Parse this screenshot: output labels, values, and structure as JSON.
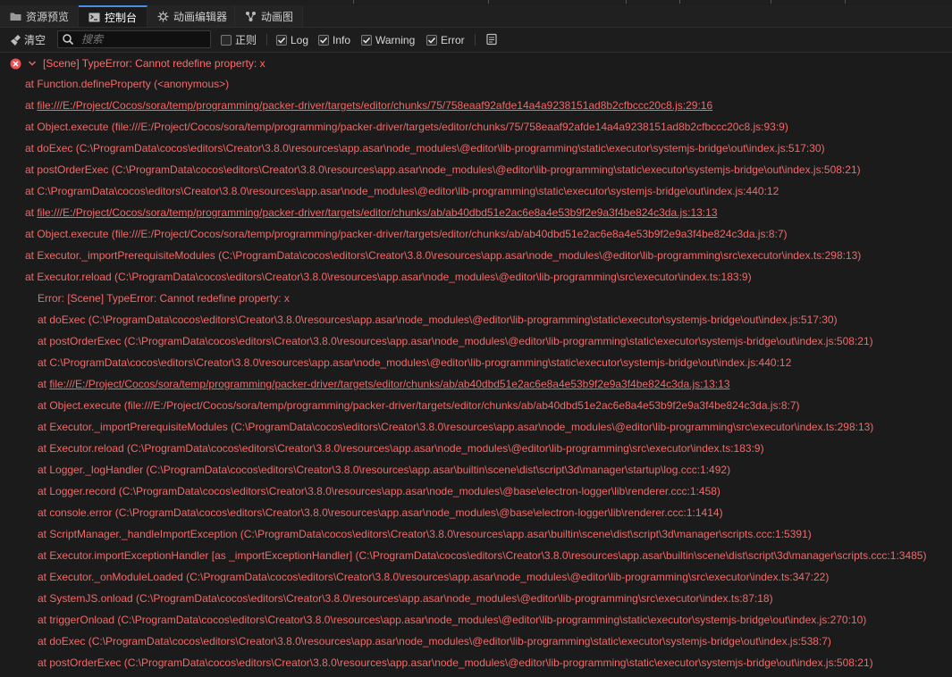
{
  "tabs": [
    {
      "label": "资源预览",
      "icon": "folder-icon",
      "active": false
    },
    {
      "label": "控制台",
      "icon": "terminal-icon",
      "active": true
    },
    {
      "label": "动画编辑器",
      "icon": "animation-editor-icon",
      "active": false
    },
    {
      "label": "动画图",
      "icon": "animation-graph-icon",
      "active": false
    }
  ],
  "toolbar": {
    "clear_label": "清空",
    "search_placeholder": "搜索",
    "regex_label": "正则",
    "log_label": "Log",
    "info_label": "Info",
    "warning_label": "Warning",
    "error_label": "Error",
    "regex_checked": false,
    "log_checked": true,
    "info_checked": true,
    "warning_checked": true,
    "error_checked": true
  },
  "colors": {
    "error_text": "#f06a6a",
    "accent": "#4a90e2",
    "background": "#1b1b1b"
  },
  "log": {
    "header": "[Scene] TypeError: Cannot redefine property: x",
    "lines": [
      {
        "prefix": "at Function.defineProperty (<anonymous>)",
        "link": "",
        "suffix": "",
        "indent": 1
      },
      {
        "prefix": "at ",
        "link": "file:///E:/Project/Cocos/sora/temp/programming/packer-driver/targets/editor/chunks/75/758eaaf92afde14a4a9238151ad8b2cfbccc20c8.js:29:16",
        "suffix": "",
        "indent": 1
      },
      {
        "prefix": "at Object.execute (file:///E:/Project/Cocos/sora/temp/programming/packer-driver/targets/editor/chunks/75/758eaaf92afde14a4a9238151ad8b2cfbccc20c8.js:93:9)",
        "link": "",
        "suffix": "",
        "indent": 1
      },
      {
        "prefix": "at doExec (C:\\ProgramData\\cocos\\editors\\Creator\\3.8.0\\resources\\app.asar\\node_modules\\@editor\\lib-programming\\static\\executor\\systemjs-bridge\\out\\index.js:517:30)",
        "link": "",
        "suffix": "",
        "indent": 1
      },
      {
        "prefix": "at postOrderExec (C:\\ProgramData\\cocos\\editors\\Creator\\3.8.0\\resources\\app.asar\\node_modules\\@editor\\lib-programming\\static\\executor\\systemjs-bridge\\out\\index.js:508:21)",
        "link": "",
        "suffix": "",
        "indent": 1
      },
      {
        "prefix": "at C:\\ProgramData\\cocos\\editors\\Creator\\3.8.0\\resources\\app.asar\\node_modules\\@editor\\lib-programming\\static\\executor\\systemjs-bridge\\out\\index.js:440:12",
        "link": "",
        "suffix": "",
        "indent": 1
      },
      {
        "prefix": "at ",
        "link": "file:///E:/Project/Cocos/sora/temp/programming/packer-driver/targets/editor/chunks/ab/ab40dbd51e2ac6e8a4e53b9f2e9a3f4be824c3da.js:13:13",
        "suffix": "",
        "indent": 1
      },
      {
        "prefix": "at Object.execute (file:///E:/Project/Cocos/sora/temp/programming/packer-driver/targets/editor/chunks/ab/ab40dbd51e2ac6e8a4e53b9f2e9a3f4be824c3da.js:8:7)",
        "link": "",
        "suffix": "",
        "indent": 1
      },
      {
        "prefix": "at Executor._importPrerequisiteModules (C:\\ProgramData\\cocos\\editors\\Creator\\3.8.0\\resources\\app.asar\\node_modules\\@editor\\lib-programming\\src\\executor\\index.ts:298:13)",
        "link": "",
        "suffix": "",
        "indent": 1
      },
      {
        "prefix": "at Executor.reload (C:\\ProgramData\\cocos\\editors\\Creator\\3.8.0\\resources\\app.asar\\node_modules\\@editor\\lib-programming\\src\\executor\\index.ts:183:9)",
        "link": "",
        "suffix": "",
        "indent": 1
      },
      {
        "prefix": "Error: [Scene] TypeError: Cannot redefine property: x",
        "link": "",
        "suffix": "",
        "indent": 2
      },
      {
        "prefix": "at doExec (C:\\ProgramData\\cocos\\editors\\Creator\\3.8.0\\resources\\app.asar\\node_modules\\@editor\\lib-programming\\static\\executor\\systemjs-bridge\\out\\index.js:517:30)",
        "link": "",
        "suffix": "",
        "indent": 2
      },
      {
        "prefix": "at postOrderExec (C:\\ProgramData\\cocos\\editors\\Creator\\3.8.0\\resources\\app.asar\\node_modules\\@editor\\lib-programming\\static\\executor\\systemjs-bridge\\out\\index.js:508:21)",
        "link": "",
        "suffix": "",
        "indent": 2
      },
      {
        "prefix": "at C:\\ProgramData\\cocos\\editors\\Creator\\3.8.0\\resources\\app.asar\\node_modules\\@editor\\lib-programming\\static\\executor\\systemjs-bridge\\out\\index.js:440:12",
        "link": "",
        "suffix": "",
        "indent": 2
      },
      {
        "prefix": "at ",
        "link": "file:///E:/Project/Cocos/sora/temp/programming/packer-driver/targets/editor/chunks/ab/ab40dbd51e2ac6e8a4e53b9f2e9a3f4be824c3da.js:13:13",
        "suffix": "",
        "indent": 2
      },
      {
        "prefix": "at Object.execute (file:///E:/Project/Cocos/sora/temp/programming/packer-driver/targets/editor/chunks/ab/ab40dbd51e2ac6e8a4e53b9f2e9a3f4be824c3da.js:8:7)",
        "link": "",
        "suffix": "",
        "indent": 2
      },
      {
        "prefix": "at Executor._importPrerequisiteModules (C:\\ProgramData\\cocos\\editors\\Creator\\3.8.0\\resources\\app.asar\\node_modules\\@editor\\lib-programming\\src\\executor\\index.ts:298:13)",
        "link": "",
        "suffix": "",
        "indent": 2
      },
      {
        "prefix": "at Executor.reload (C:\\ProgramData\\cocos\\editors\\Creator\\3.8.0\\resources\\app.asar\\node_modules\\@editor\\lib-programming\\src\\executor\\index.ts:183:9)",
        "link": "",
        "suffix": "",
        "indent": 2
      },
      {
        "prefix": "at Logger._logHandler (C:\\ProgramData\\cocos\\editors\\Creator\\3.8.0\\resources\\app.asar\\builtin\\scene\\dist\\script\\3d\\manager\\startup\\log.ccc:1:492)",
        "link": "",
        "suffix": "",
        "indent": 2
      },
      {
        "prefix": "at Logger.record (C:\\ProgramData\\cocos\\editors\\Creator\\3.8.0\\resources\\app.asar\\node_modules\\@base\\electron-logger\\lib\\renderer.ccc:1:458)",
        "link": "",
        "suffix": "",
        "indent": 2
      },
      {
        "prefix": "at console.error (C:\\ProgramData\\cocos\\editors\\Creator\\3.8.0\\resources\\app.asar\\node_modules\\@base\\electron-logger\\lib\\renderer.ccc:1:1414)",
        "link": "",
        "suffix": "",
        "indent": 2
      },
      {
        "prefix": "at ScriptManager._handleImportException (C:\\ProgramData\\cocos\\editors\\Creator\\3.8.0\\resources\\app.asar\\builtin\\scene\\dist\\script\\3d\\manager\\scripts.ccc:1:5391)",
        "link": "",
        "suffix": "",
        "indent": 2
      },
      {
        "prefix": "at Executor.importExceptionHandler [as _importExceptionHandler] (C:\\ProgramData\\cocos\\editors\\Creator\\3.8.0\\resources\\app.asar\\builtin\\scene\\dist\\script\\3d\\manager\\scripts.ccc:1:3485)",
        "link": "",
        "suffix": "",
        "indent": 2
      },
      {
        "prefix": "at Executor._onModuleLoaded (C:\\ProgramData\\cocos\\editors\\Creator\\3.8.0\\resources\\app.asar\\node_modules\\@editor\\lib-programming\\src\\executor\\index.ts:347:22)",
        "link": "",
        "suffix": "",
        "indent": 2
      },
      {
        "prefix": "at SystemJS.onload (C:\\ProgramData\\cocos\\editors\\Creator\\3.8.0\\resources\\app.asar\\node_modules\\@editor\\lib-programming\\src\\executor\\index.ts:87:18)",
        "link": "",
        "suffix": "",
        "indent": 2
      },
      {
        "prefix": "at triggerOnload (C:\\ProgramData\\cocos\\editors\\Creator\\3.8.0\\resources\\app.asar\\node_modules\\@editor\\lib-programming\\static\\executor\\systemjs-bridge\\out\\index.js:270:10)",
        "link": "",
        "suffix": "",
        "indent": 2
      },
      {
        "prefix": "at doExec (C:\\ProgramData\\cocos\\editors\\Creator\\3.8.0\\resources\\app.asar\\node_modules\\@editor\\lib-programming\\static\\executor\\systemjs-bridge\\out\\index.js:538:7)",
        "link": "",
        "suffix": "",
        "indent": 2
      },
      {
        "prefix": "at postOrderExec (C:\\ProgramData\\cocos\\editors\\Creator\\3.8.0\\resources\\app.asar\\node_modules\\@editor\\lib-programming\\static\\executor\\systemjs-bridge\\out\\index.js:508:21)",
        "link": "",
        "suffix": "",
        "indent": 2
      }
    ]
  }
}
